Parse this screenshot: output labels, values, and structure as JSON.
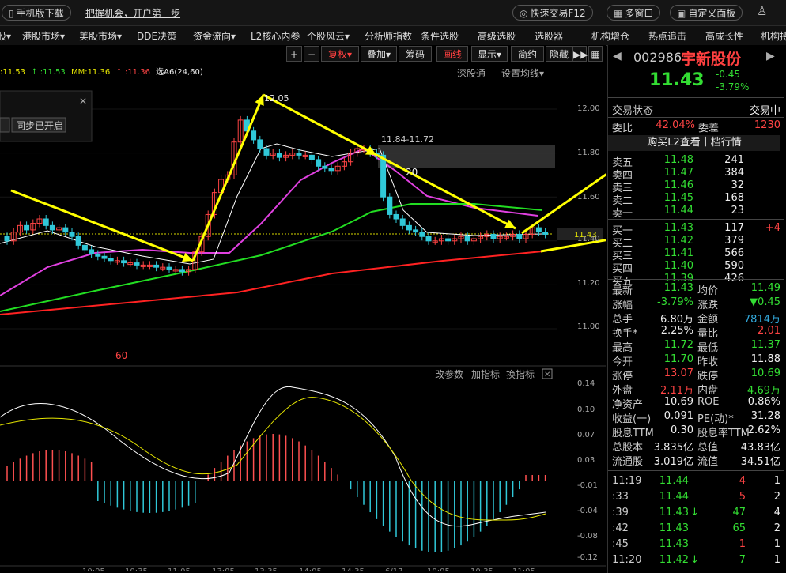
{
  "topbar": {
    "mobile_download": "手机版下载",
    "promo": "把握机会，开户第一步",
    "quick_trade": "快速交易F12",
    "multi_window": "多窗口",
    "custom_panel": "自定义面板"
  },
  "menu": [
    "股▾",
    "港股市场▾",
    "美股市场▾",
    "DDE决策",
    "资金流向▾",
    "L2核心内参",
    "个股风云▾",
    "分析师指数",
    "条件选股",
    "高级选股",
    "选股器",
    "机构增仓",
    "热点追击",
    "高成长性",
    "机构持"
  ],
  "toolbar": {
    "plus": "+",
    "minus": "−",
    "fuquan": "复权▾",
    "diejia": "叠加▾",
    "chouma": "筹码",
    "huaxian": "画线",
    "xianshi": "显示▾",
    "jianyue": "简约",
    "yincang": "隐藏",
    "arrows": "▶▶"
  },
  "legend": [
    {
      "text": ":11.53",
      "color": "#e8e800"
    },
    {
      "text": "↑ :11.53",
      "color": "#33dd33"
    },
    {
      "text": "MM:11.36",
      "color": "#e8e800"
    },
    {
      "text": "↑ :11.36",
      "color": "#ff4444"
    },
    {
      "text": "选A6(24,60)",
      "color": "#eee"
    }
  ],
  "chart_labels": {
    "shenguton": "深股通",
    "setma": "设置均线▾",
    "sync": "同步已开启",
    "high_note": "12.05",
    "range_note": "11.84-11.72",
    "num20": "20",
    "num60": "60",
    "cur_price": "11.43",
    "gaicanshu": "改参数",
    "jiazhibiao": "加指标",
    "huanzhibiao": "换指标"
  },
  "price_axis": [
    "12.00",
    "11.80",
    "11.60",
    "11.40",
    "11.20",
    "11.00"
  ],
  "macd_axis": [
    "0.14",
    "0.10",
    "0.07",
    "0.03",
    "-0.01",
    "-0.04",
    "-0.08",
    "-0.12"
  ],
  "time_axis": [
    "10:05",
    "10:35",
    "11:05",
    "13:05",
    "13:35",
    "14:05",
    "14:35",
    "6/17",
    "10:05",
    "10:35",
    "11:05"
  ],
  "stock": {
    "code": "002986",
    "name": "宇新股份",
    "price": "11.43",
    "change": "-0.45",
    "pct": "-3.79%"
  },
  "status": {
    "label": "交易状态",
    "value": "交易中"
  },
  "weibi": {
    "l1": "委比",
    "v1": "42.04%",
    "l2": "委差",
    "v2": "1230"
  },
  "l2_link": "购买L2查看十档行情",
  "asks": [
    {
      "label": "卖五",
      "price": "11.48",
      "vol": "241"
    },
    {
      "label": "卖四",
      "price": "11.47",
      "vol": "384"
    },
    {
      "label": "卖三",
      "price": "11.46",
      "vol": "32"
    },
    {
      "label": "卖二",
      "price": "11.45",
      "vol": "168"
    },
    {
      "label": "卖一",
      "price": "11.44",
      "vol": "23"
    }
  ],
  "bids": [
    {
      "label": "买一",
      "price": "11.43",
      "vol": "117",
      "extra": "+4"
    },
    {
      "label": "买二",
      "price": "11.42",
      "vol": "379",
      "extra": ""
    },
    {
      "label": "买三",
      "price": "11.41",
      "vol": "566",
      "extra": ""
    },
    {
      "label": "买四",
      "price": "11.40",
      "vol": "590",
      "extra": ""
    },
    {
      "label": "买五",
      "price": "11.39",
      "vol": "426",
      "extra": ""
    }
  ],
  "stats": [
    {
      "l1": "最新",
      "v1": "11.43",
      "c1": "g",
      "l2": "均价",
      "v2": "11.49",
      "c2": "g"
    },
    {
      "l1": "涨幅",
      "v1": "-3.79%",
      "c1": "g",
      "l2": "涨跌",
      "v2": "▼0.45",
      "c2": "g"
    },
    {
      "l1": "总手",
      "v1": "6.80万",
      "c1": "w",
      "l2": "金额",
      "v2": "7814万",
      "c2": "c"
    },
    {
      "l1": "换手*",
      "v1": "2.25%",
      "c1": "w",
      "l2": "量比",
      "v2": "2.01",
      "c2": "r"
    },
    {
      "l1": "最高",
      "v1": "11.72",
      "c1": "g",
      "l2": "最低",
      "v2": "11.37",
      "c2": "g"
    },
    {
      "l1": "今开",
      "v1": "11.70",
      "c1": "g",
      "l2": "昨收",
      "v2": "11.88",
      "c2": "w"
    },
    {
      "l1": "涨停",
      "v1": "13.07",
      "c1": "r",
      "l2": "跌停",
      "v2": "10.69",
      "c2": "g"
    },
    {
      "l1": "外盘",
      "v1": "2.11万",
      "c1": "r",
      "l2": "内盘",
      "v2": "4.69万",
      "c2": "g"
    },
    {
      "l1": "净资产",
      "v1": "10.69",
      "c1": "w",
      "l2": "ROE",
      "v2": "0.86%",
      "c2": "w"
    },
    {
      "l1": "收益(一)",
      "v1": "0.091",
      "c1": "w",
      "l2": "PE(动)*",
      "v2": "31.28",
      "c2": "w"
    },
    {
      "l1": "股息TTM",
      "v1": "0.30",
      "c1": "w",
      "l2": "股息率TTM",
      "v2": "2.62%",
      "c2": "w"
    },
    {
      "l1": "总股本",
      "v1": "3.835亿",
      "c1": "w",
      "l2": "总值",
      "v2": "43.83亿",
      "c2": "w"
    },
    {
      "l1": "流通股",
      "v1": "3.019亿",
      "c1": "w",
      "l2": "流值",
      "v2": "34.51亿",
      "c2": "w"
    }
  ],
  "ticks": [
    {
      "t": "11:19",
      "p": "11.44",
      "v": "4",
      "vc": "r",
      "n": "1",
      "a": ""
    },
    {
      "t": ":33",
      "p": "11.44",
      "v": "5",
      "vc": "r",
      "n": "2",
      "a": ""
    },
    {
      "t": ":39",
      "p": "11.43",
      "v": "47",
      "vc": "g",
      "n": "4",
      "a": "↓"
    },
    {
      "t": ":42",
      "p": "11.43",
      "v": "65",
      "vc": "g",
      "n": "2",
      "a": ""
    },
    {
      "t": ":45",
      "p": "11.43",
      "v": "1",
      "vc": "r",
      "n": "1",
      "a": ""
    },
    {
      "t": "11:20",
      "p": "11.42",
      "v": "7",
      "vc": "g",
      "n": "1",
      "a": "↓"
    }
  ],
  "colors": {
    "up": "#ff4444",
    "down": "#33dd33",
    "ma_magenta": "#e040e0",
    "ma_green": "#22dd22",
    "ma_red": "#ff2222",
    "arrow": "#ffff00",
    "macd_pos": "#ff5050",
    "macd_neg": "#30c8d8"
  }
}
